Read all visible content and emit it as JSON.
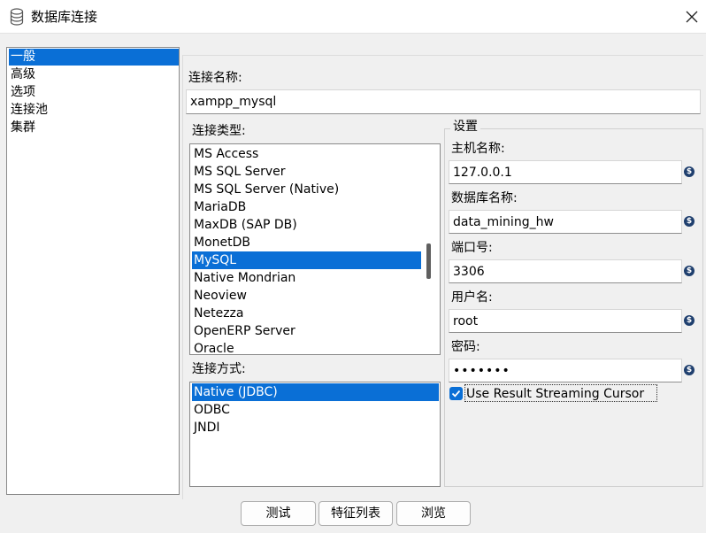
{
  "window": {
    "title": "数据库连接",
    "app_icon": "database-icon",
    "close_icon": "close-icon"
  },
  "sidebar": {
    "items": [
      {
        "label": "一般",
        "selected": true
      },
      {
        "label": "高级",
        "selected": false
      },
      {
        "label": "选项",
        "selected": false
      },
      {
        "label": "连接池",
        "selected": false
      },
      {
        "label": "集群",
        "selected": false
      }
    ]
  },
  "general": {
    "connection_name_label": "连接名称:",
    "connection_name_value": "xampp_mysql",
    "connection_type_label": "连接类型:",
    "connection_types": [
      {
        "label": "MS Access",
        "selected": false
      },
      {
        "label": "MS SQL Server",
        "selected": false
      },
      {
        "label": "MS SQL Server (Native)",
        "selected": false
      },
      {
        "label": "MariaDB",
        "selected": false
      },
      {
        "label": "MaxDB (SAP DB)",
        "selected": false
      },
      {
        "label": "MonetDB",
        "selected": false
      },
      {
        "label": "MySQL",
        "selected": true
      },
      {
        "label": "Native Mondrian",
        "selected": false
      },
      {
        "label": "Neoview",
        "selected": false
      },
      {
        "label": "Netezza",
        "selected": false
      },
      {
        "label": "OpenERP Server",
        "selected": false
      },
      {
        "label": "Oracle",
        "selected": false
      }
    ],
    "access_label": "连接方式:",
    "access_methods": [
      {
        "label": "Native (JDBC)",
        "selected": true
      },
      {
        "label": "ODBC",
        "selected": false
      },
      {
        "label": "JNDI",
        "selected": false
      }
    ]
  },
  "settings": {
    "title": "设置",
    "host_label": "主机名称:",
    "host_value": "127.0.0.1",
    "db_label": "数据库名称:",
    "db_value": "data_mining_hw",
    "port_label": "端口号:",
    "port_value": "3306",
    "user_label": "用户名:",
    "user_value": "root",
    "password_label": "密码:",
    "password_value": "•••••••",
    "variable_icon": "variable-icon",
    "streaming_cursor_label": "Use Result Streaming Cursor",
    "streaming_cursor_checked": true
  },
  "buttons": {
    "test": "测试",
    "features": "特征列表",
    "browse": "浏览"
  },
  "colors": {
    "selection": "#0a6fd6",
    "background": "#f0f0f0",
    "variable_icon": "#1f3f6e"
  }
}
